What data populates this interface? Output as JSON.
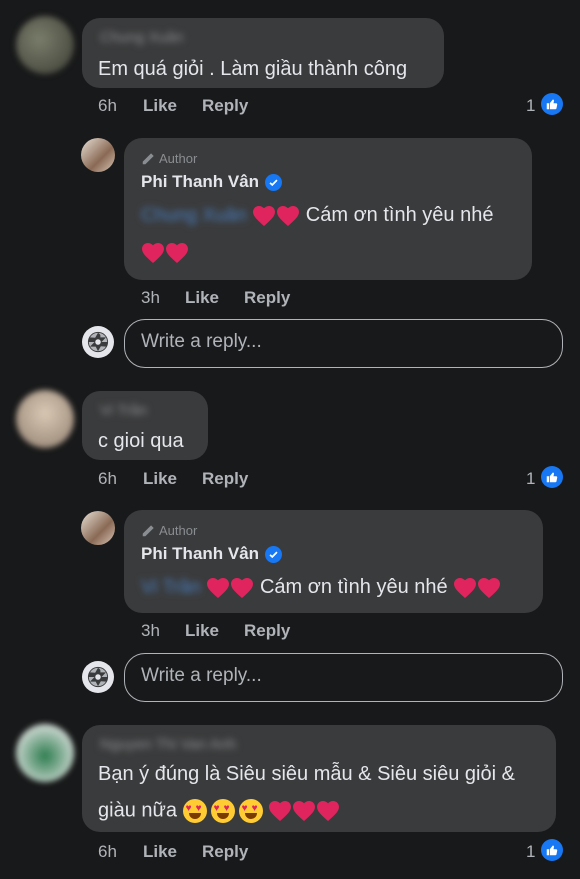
{
  "comments": [
    {
      "author": "Chung Xuân",
      "text": "Em quá giỏi . Làm giầu thành công",
      "time": "6h",
      "like_label": "Like",
      "reply_label": "Reply",
      "reaction_count": "1",
      "reply": {
        "tag": "Author",
        "name": "Phi Thanh Vân",
        "mention": "Chung Xuân",
        "text": "Cám ơn tình yêu nhé",
        "time": "3h",
        "like_label": "Like",
        "reply_label": "Reply"
      },
      "write_reply_placeholder": "Write a reply..."
    },
    {
      "author": "Vi Trần",
      "text": "c gioi qua",
      "time": "6h",
      "like_label": "Like",
      "reply_label": "Reply",
      "reaction_count": "1",
      "reply": {
        "tag": "Author",
        "name": "Phi Thanh Vân",
        "mention": "Vi Trần",
        "text": "Cám ơn tình yêu nhé",
        "time": "3h",
        "like_label": "Like",
        "reply_label": "Reply"
      },
      "write_reply_placeholder": "Write a reply..."
    },
    {
      "author": "Nguyen Thi Van Anh",
      "text_line1": "Bạn ý đúng là Siêu siêu mẫu & Siêu siêu giỏi &",
      "text_line2": "giàu nữa",
      "time": "6h",
      "like_label": "Like",
      "reply_label": "Reply",
      "reaction_count": "1"
    }
  ],
  "colors": {
    "background": "#18191a",
    "bubble": "#3a3b3c",
    "accent": "#1877f2",
    "heart": "#e0245e"
  },
  "icons": [
    "like-icon",
    "verified-icon",
    "pen-icon",
    "heart-icon",
    "heart-eyes-icon"
  ]
}
